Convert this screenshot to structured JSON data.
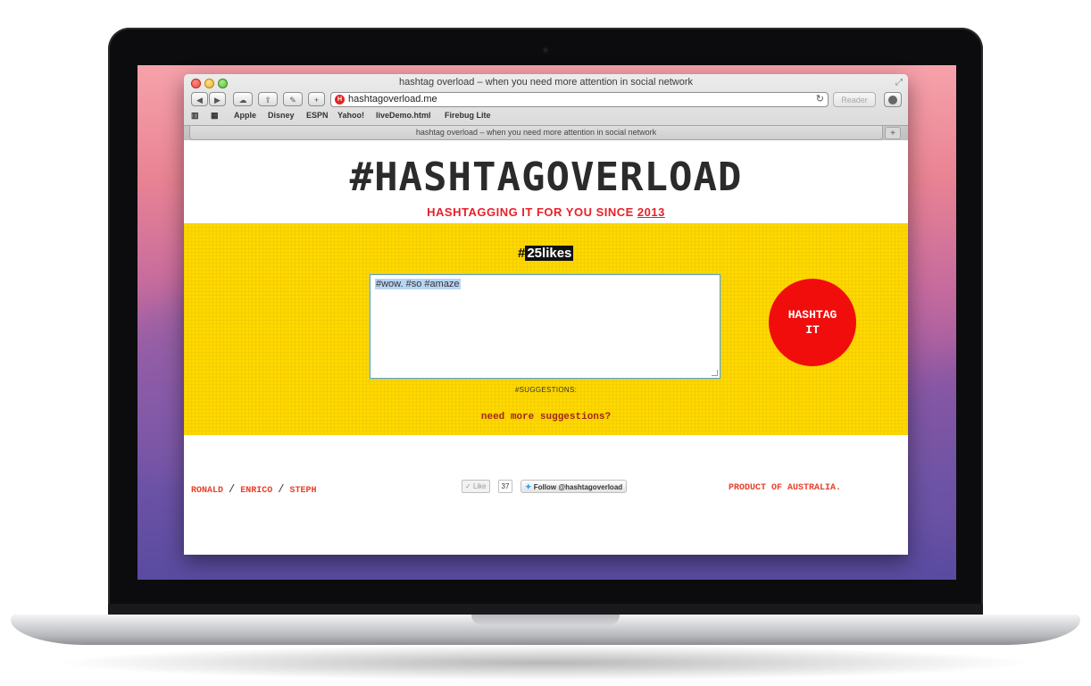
{
  "browser": {
    "window_title": "hashtag overload – when you need more attention in social network",
    "url": "hashtagoverload.me",
    "reader_label": "Reader",
    "bookmarks": [
      "Apple",
      "Disney",
      "ESPN",
      "Yahoo!",
      "liveDemo.html",
      "Firebug Lite"
    ],
    "tab_title": "hashtag overload – when you need more attention in social network",
    "new_tab": "+"
  },
  "page": {
    "logo": "#HASHTAGOVERLOAD",
    "tagline_prefix": "HASHTAGGING IT FOR YOU SINCE ",
    "tagline_year": "2013",
    "likes_hash": "#",
    "likes_text": "25likes",
    "textarea_value": "#wow. #so #amaze",
    "hashtag_button": "HASHTAG IT",
    "suggestions_label": "#SUGGESTIONS:",
    "more_suggestions_link": "need more suggestions?",
    "authors": [
      "RONALD",
      "ENRICO",
      "STEPH"
    ],
    "author_separator": "/",
    "like_label": "Like",
    "like_count": "37",
    "follow_label": "Follow @hashtagoverload",
    "product_of": "PRODUCT OF AUSTRALIA."
  },
  "colors": {
    "accent_red": "#f20d0d",
    "banner_yellow": "#ffd800",
    "link_orange": "#e8402a"
  }
}
